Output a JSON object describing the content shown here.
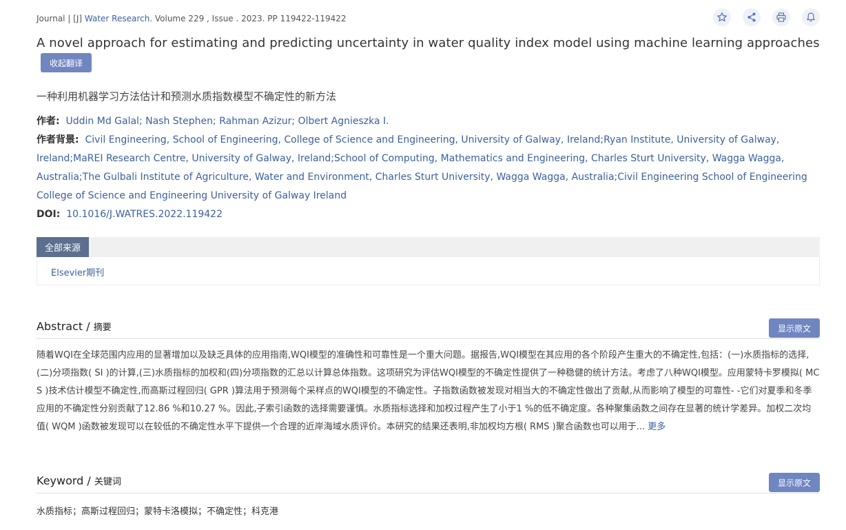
{
  "meta": {
    "prefix": "Journal | [J] ",
    "journal": "Water Research",
    "rest": ". Volume 229 , Issue . 2023. PP 119422-119422"
  },
  "actions": {
    "icons": [
      "star-icon",
      "share-icon",
      "print-icon",
      "bell-icon"
    ]
  },
  "title_en": "A novel approach for estimating and predicting uncertainty in water quality index model using machine learning approaches",
  "translate_button": "收起翻译",
  "title_cn": "一种利用机器学习方法估计和预测水质指数模型不确定性的新方法",
  "authors": {
    "label": "作者:",
    "value": "Uddin Md Galal; Nash Stephen; Rahman Azizur; Olbert Agnieszka I."
  },
  "affiliation": {
    "label": "作者背景:",
    "value": "Civil Engineering, School of Engineering, College of Science and Engineering, University of Galway, Ireland;Ryan Institute, University of Galway, Ireland;MaREI Research Centre, University of Galway, Ireland;School of Computing, Mathematics and Engineering, Charles Sturt University, Wagga Wagga, Australia;The Gulbali Institute of Agriculture, Water and Environment, Charles Sturt University, Wagga Wagga, Australia;Civil Engineering School of Engineering College of Science and Engineering University of Galway Ireland"
  },
  "doi": {
    "label": "DOI:",
    "value": "10.1016/J.WATRES.2022.119422"
  },
  "sources": {
    "tab_label": "全部来源",
    "items": [
      "Elsevier期刊"
    ]
  },
  "abstract": {
    "title": "Abstract",
    "slash": " / ",
    "subtitle": "摘要",
    "button": "显示原文",
    "text": "随着WQI在全球范围内应用的显著增加以及缺乏具体的应用指南,WQI模型的准确性和可靠性是一个重大问题。据报告,WQI模型在其应用的各个阶段产生重大的不确定性,包括：(一)水质指标的选择,(二)分项指数( SI )的计算,(三)水质指标的加权和(四)分项指数的汇总以计算总体指数。这项研究为评估WQI模型的不确定性提供了一种稳健的统计方法。考虑了八种WQI模型。应用蒙特卡罗模拟( MCS )技术估计模型不确定性,而高斯过程回归( GPR )算法用于预测每个采样点的WQI模型的不确定性。子指数函数被发现对相当大的不确定性做出了贡献,从而影响了模型的可靠性- -它们对夏季和冬季应用的不确定性分别贡献了12.86 %和10.27 %。因此,子索引函数的选择需要谨慎。水质指标选择和加权过程产生了小于1 %的低不确定度。各种聚集函数之间存在显著的统计学差异。加权二次均值( WQM )函数被发现可以在较低的不确定性水平下提供一个合理的近岸海域水质评价。本研究的结果还表明,非加权均方根( RMS )聚合函数也可以用于...",
    "more": "更多"
  },
  "keywords": {
    "title": "Keyword",
    "slash": " / ",
    "subtitle": "关键词",
    "button": "显示原文",
    "text": "水质指标；高斯过程回归；蒙特卡洛模拟；不确定性；科克港"
  }
}
